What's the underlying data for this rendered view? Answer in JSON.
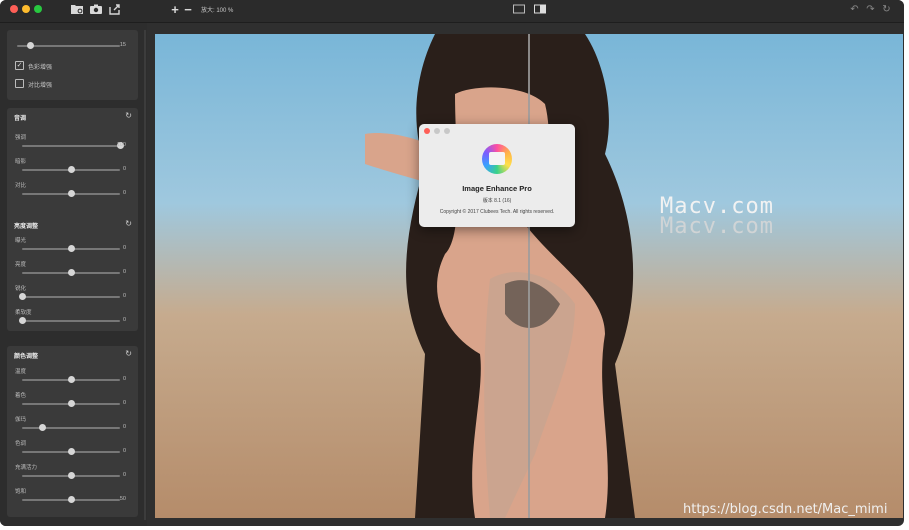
{
  "toolbar": {
    "zoom_in_label": "+",
    "zoom_out_label": "−",
    "zoom_text": "放大: 100 %"
  },
  "sidebar": {
    "top_panel": {
      "slider_value": "15",
      "checkboxes": [
        {
          "label": "色彩增强",
          "checked": true
        },
        {
          "label": "对比增强",
          "checked": false
        }
      ]
    },
    "tone": {
      "title": "音调",
      "sliders": [
        {
          "label": "强调",
          "value": "100",
          "level": 1.0
        },
        {
          "label": "暗影",
          "value": "0",
          "level": 0.5
        },
        {
          "label": "对比",
          "value": "0",
          "level": 0.5
        }
      ]
    },
    "brightness": {
      "title": "亮度调整",
      "sliders": [
        {
          "label": "曝光",
          "value": "0",
          "level": 0.5
        },
        {
          "label": "亮度",
          "value": "0",
          "level": 0.5
        },
        {
          "label": "锐化",
          "value": "0",
          "level": 0.0
        },
        {
          "label": "柔软度",
          "value": "0",
          "level": 0.0
        }
      ]
    },
    "color": {
      "title": "颜色调整",
      "sliders": [
        {
          "label": "温度",
          "value": "0",
          "level": 0.5
        },
        {
          "label": "着色",
          "value": "0",
          "level": 0.5
        },
        {
          "label": "伽玛",
          "value": "0",
          "level": 0.2
        },
        {
          "label": "色调",
          "value": "0",
          "level": 0.5
        },
        {
          "label": "充满活力",
          "value": "0",
          "level": 0.5
        },
        {
          "label": "饱和",
          "value": "50",
          "level": 0.5
        }
      ]
    }
  },
  "about": {
    "app_name": "Image Enhance Pro",
    "version": "版本 8.1 (16)",
    "copyright": "Copyright © 2017 Clubees Tech. All rights reserved."
  },
  "watermarks": {
    "primary": "Macv.com",
    "secondary": "Macv.com",
    "footer": "https://blog.csdn.net/Mac_mimi"
  },
  "colors": {
    "close": "#fe5f57",
    "minimize": "#febc2e",
    "zoom": "#28c840"
  }
}
